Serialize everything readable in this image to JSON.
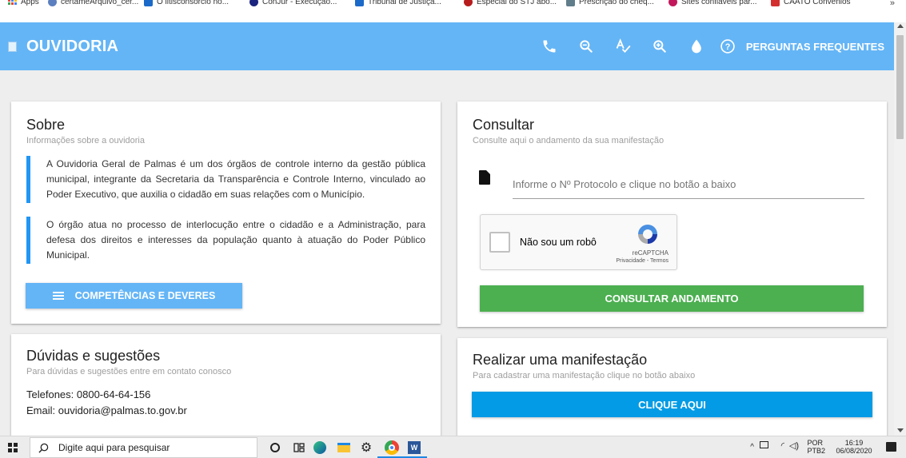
{
  "bookmarks": {
    "items": [
      {
        "label": "Apps",
        "icon": "apps-grid-icon",
        "color": "#4285f4"
      },
      {
        "label": "certameArquivo_cer...",
        "icon": "cloud-icon",
        "color": "#5b7fbf"
      },
      {
        "label": "O litisconsórcio no...",
        "icon": "site-favicon",
        "color": "#1b6ac9"
      },
      {
        "label": "ConJur - Execução...",
        "icon": "site-favicon",
        "color": "#1a237e"
      },
      {
        "label": "Tribunal de Justiça...",
        "icon": "site-favicon",
        "color": "#1b6ac9"
      },
      {
        "label": "Especial do STJ abo...",
        "icon": "site-favicon",
        "color": "#b71c1c"
      },
      {
        "label": "Prescrição do cheq...",
        "icon": "site-favicon",
        "color": "#607d8b"
      },
      {
        "label": "Sites confiáveis par...",
        "icon": "site-favicon",
        "color": "#c2185b"
      },
      {
        "label": "CAATO Convênios",
        "icon": "site-favicon",
        "color": "#d32f2f"
      }
    ],
    "more": "»"
  },
  "header": {
    "title": "OUVIDORIA",
    "tools": [
      {
        "name": "phone-icon",
        "label": "Telefone"
      },
      {
        "name": "zoom-out-icon",
        "label": "Diminuir zoom"
      },
      {
        "name": "spellcheck-icon",
        "label": "Fonte"
      },
      {
        "name": "zoom-in-icon",
        "label": "Aumentar zoom"
      },
      {
        "name": "contrast-icon",
        "label": "Contraste"
      }
    ],
    "faq_label": "PERGUNTAS FREQUENTES",
    "color": "#64b5f6"
  },
  "sobre": {
    "title": "Sobre",
    "subtitle": "Informações sobre a ouvidoria",
    "paragraph1": "A Ouvidoria Geral de Palmas é um dos órgãos de controle interno da gestão pública municipal, integrante da Secretaria da Transparência e Controle Interno, vinculado ao Poder Executivo, que auxilia o cidadão em suas relações com o Município.",
    "paragraph2": "O órgão atua no processo de interlocução entre o cidadão e a Administração, para defesa dos direitos e interesses da população quanto à atuação do Poder Público Municipal.",
    "button_label": "COMPETÊNCIAS E DEVERES"
  },
  "consultar": {
    "title": "Consultar",
    "subtitle": "Consulte aqui o andamento da sua manifestação",
    "protocol_placeholder": "Informe o Nº Protocolo e clique no botão a baixo",
    "protocol_value": "",
    "recaptcha": {
      "checkbox_label": "Não sou um robô",
      "brand": "reCAPTCHA",
      "links": "Privacidade - Termos",
      "checked": false
    },
    "button_label": "CONSULTAR ANDAMENTO",
    "button_color": "#4caf50"
  },
  "duvidas": {
    "title": "Dúvidas e sugestões",
    "subtitle": "Para dúvidas e sugestões entre em contato conosco",
    "phones": "Telefones: 0800-64-64-156",
    "email": "Email: ouvidoria@palmas.to.gov.br"
  },
  "manifestacao": {
    "title": "Realizar uma manifestação",
    "subtitle": "Para cadastrar uma manifestação clique no botão abaixo",
    "button_label": "CLIQUE AQUI",
    "button_color": "#039be5"
  },
  "taskbar": {
    "search_placeholder": "Digite aqui para pesquisar",
    "lang_top": "POR",
    "lang_bottom": "PTB2",
    "time": "16:19",
    "date": "06/08/2020"
  }
}
